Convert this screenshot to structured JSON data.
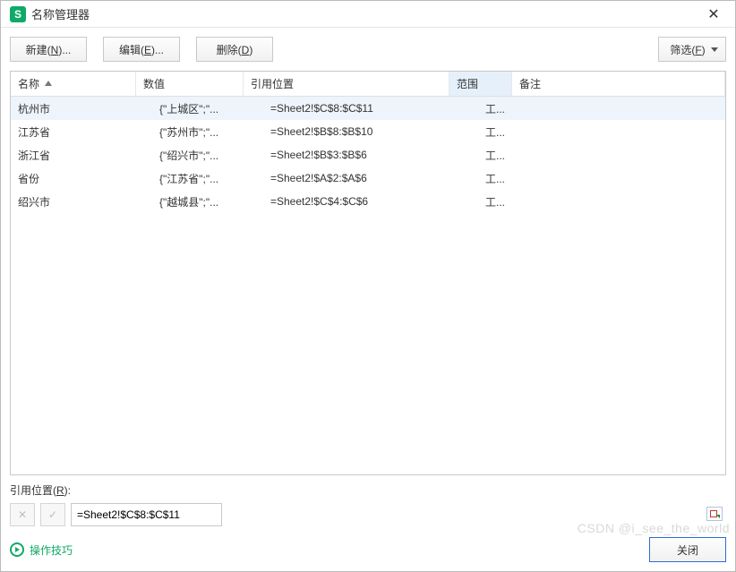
{
  "window": {
    "title": "名称管理器",
    "app_glyph": "S"
  },
  "toolbar": {
    "new_label": "新建(N)...",
    "edit_label": "编辑(E)...",
    "delete_label": "删除(D)",
    "filter_label": "筛选(F)"
  },
  "columns": {
    "name": "名称",
    "value": "数值",
    "refers_to": "引用位置",
    "scope": "范围",
    "comment": "备注"
  },
  "rows": [
    {
      "name": "杭州市",
      "value": "{\"上城区\";\"...",
      "refers_to": "=Sheet2!$C$8:$C$11",
      "scope": "工...",
      "comment": "",
      "selected": true
    },
    {
      "name": "江苏省",
      "value": "{\"苏州市\";\"...",
      "refers_to": "=Sheet2!$B$8:$B$10",
      "scope": "工...",
      "comment": "",
      "selected": false
    },
    {
      "name": "浙江省",
      "value": "{\"绍兴市\";\"...",
      "refers_to": "=Sheet2!$B$3:$B$6",
      "scope": "工...",
      "comment": "",
      "selected": false
    },
    {
      "name": "省份",
      "value": "{\"江苏省\";\"...",
      "refers_to": "=Sheet2!$A$2:$A$6",
      "scope": "工...",
      "comment": "",
      "selected": false
    },
    {
      "name": "绍兴市",
      "value": "{\"越城县\";\"...",
      "refers_to": "=Sheet2!$C$4:$C$6",
      "scope": "工...",
      "comment": "",
      "selected": false
    }
  ],
  "refers_to_section": {
    "label": "引用位置(R):",
    "value": "=Sheet2!$C$8:$C$11",
    "cancel_glyph": "✕",
    "confirm_glyph": "✓"
  },
  "footer": {
    "tips_label": "操作技巧",
    "close_label": "关闭"
  },
  "watermark": "CSDN @i_see_the_world"
}
